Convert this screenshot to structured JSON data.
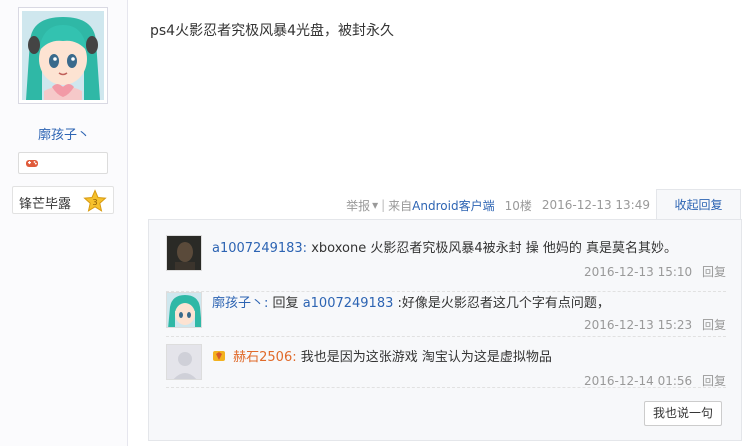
{
  "post": {
    "author": {
      "name": "廓孩子丶",
      "level_badge": "锋芒毕露"
    },
    "content": "ps4火影忍者究极风暴4光盘，被封永久",
    "tail": {
      "report": "举报",
      "report_arrow": "▾",
      "separator": "|",
      "from_prefix": "来自",
      "client": "Android客户端",
      "floor": "10楼",
      "time": "2016-12-13 13:49"
    },
    "toggle_label": "收起回复"
  },
  "comments": [
    {
      "user": "a1007249183:",
      "text": "xboxone 火影忍者究极风暴4被永封 操 他妈的 真是莫名其妙。",
      "time": "2016-12-13 15:10",
      "reply": "回复"
    },
    {
      "user": "廓孩子丶:",
      "reply_word": "回复",
      "reply_to": "a1007249183",
      "text": ":好像是火影忍者这几个字有点问题，",
      "time": "2016-12-13 15:23",
      "reply": "回复"
    },
    {
      "user": "赫石2506:",
      "text": "我也是因为这张游戏 淘宝认为这是虚拟物品",
      "time": "2016-12-14 01:56",
      "reply": "回复"
    }
  ],
  "say_button": "我也说一句",
  "colors": {
    "link": "#2d64b3",
    "meta": "#999999",
    "panel": "#f7f8fa"
  }
}
